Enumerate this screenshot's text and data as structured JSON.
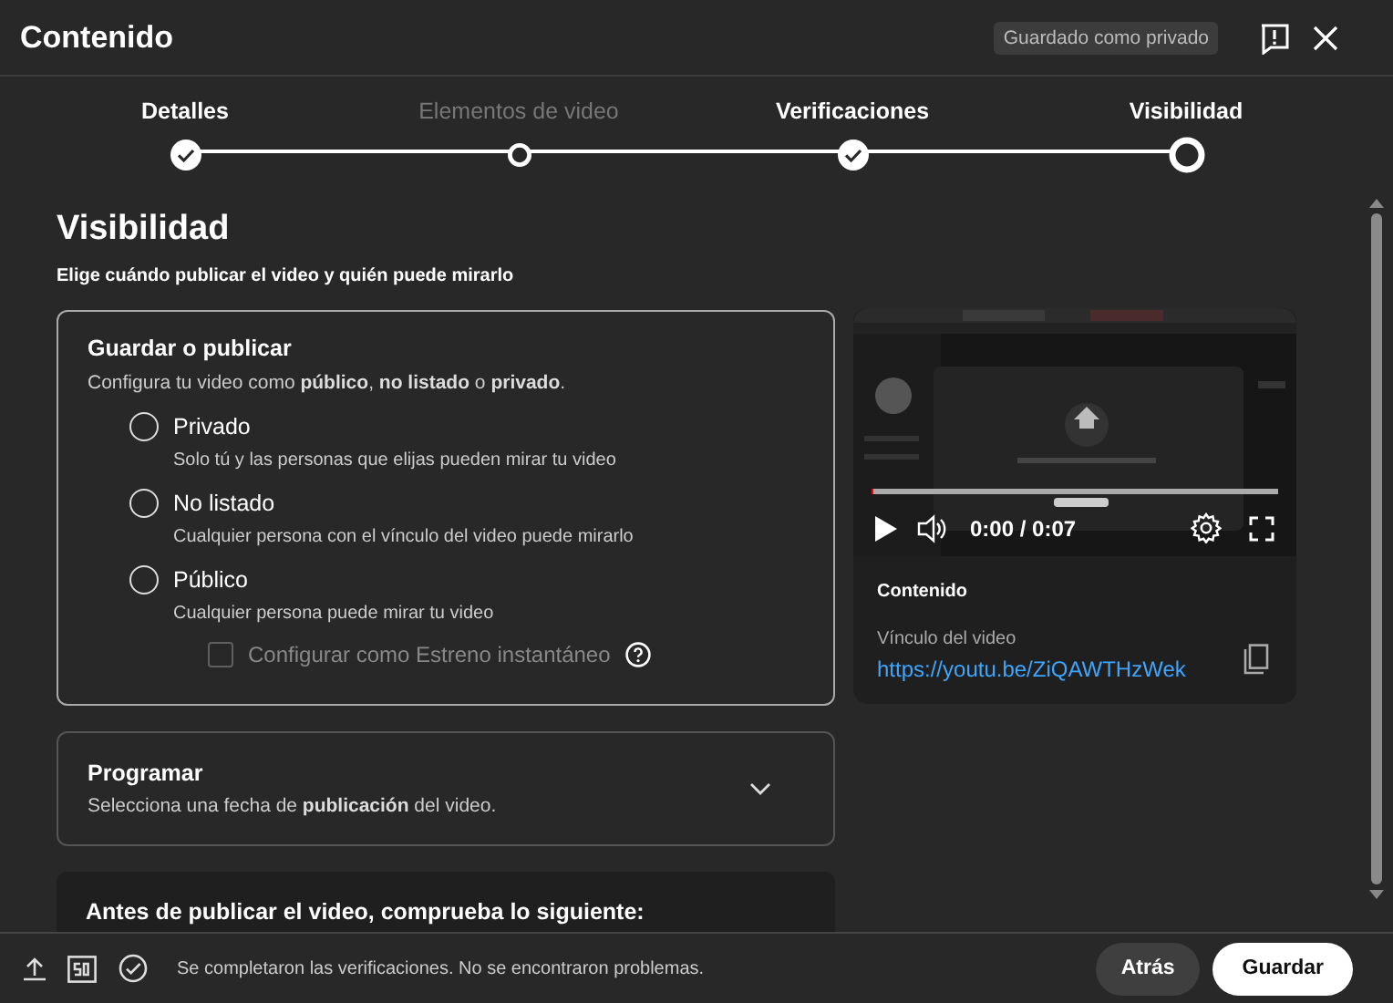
{
  "header": {
    "title": "Contenido",
    "badge": "Guardado como privado"
  },
  "steps": [
    {
      "label": "Detalles",
      "kind": "done"
    },
    {
      "label": "Elementos de video",
      "kind": "disabled"
    },
    {
      "label": "Verificaciones",
      "kind": "done"
    },
    {
      "label": "Visibilidad",
      "kind": "current"
    }
  ],
  "visibility": {
    "title": "Visibilidad",
    "subtitle": "Elige cuándo publicar el video y quién puede mirarlo",
    "save_card": {
      "title": "Guardar o publicar",
      "description": "Configura tu video como **público**, **no listado** o **privado**.",
      "options": [
        {
          "label": "Privado",
          "description": "Solo tú y las personas que elijas pueden mirar tu video",
          "selected": false
        },
        {
          "label": "No listado",
          "description": "Cualquier persona con el vínculo del video puede mirarlo",
          "selected": false
        },
        {
          "label": "Público",
          "description": "Cualquier persona puede mirar tu video",
          "selected": false
        }
      ],
      "premiere": {
        "label": "Configurar como Estreno instantáneo",
        "checked": false,
        "disabled": true
      }
    },
    "schedule_card": {
      "title": "Programar",
      "description": "Selecciona una fecha de **publicación** del video.",
      "expanded": false
    },
    "checklist_card": {
      "title": "Antes de publicar el video, comprueba lo siguiente:"
    }
  },
  "preview": {
    "level": 0,
    "time": "0:00 / 0:07",
    "title": "Contenido",
    "link_label": "Vínculo del video",
    "link": "https://youtu.be/ZiQAWTHzWek"
  },
  "footer": {
    "status": "Se completaron las verificaciones. No se encontraron problemas.",
    "buttons": [
      {
        "label": "Atrás",
        "kind": "secondary"
      },
      {
        "label": "Guardar",
        "kind": "primary"
      }
    ]
  }
}
